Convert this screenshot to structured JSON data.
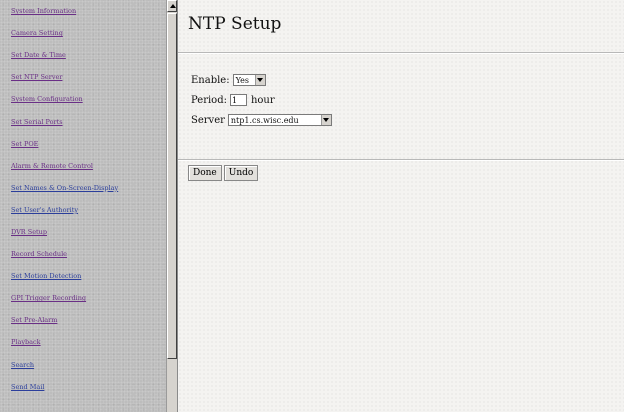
{
  "sidebar": {
    "items": [
      {
        "label": "System Information",
        "color": "#6a2f86"
      },
      {
        "label": "Camera Setting",
        "color": "#6a2f86"
      },
      {
        "label": "Set Date & Time",
        "color": "#6a2f86"
      },
      {
        "label": "Set NTP Server",
        "color": "#6a2f86"
      },
      {
        "label": "System Configuration",
        "color": "#6a2f86"
      },
      {
        "label": "Set Serial Ports",
        "color": "#6a2f86"
      },
      {
        "label": "Set POE",
        "color": "#6a2f86"
      },
      {
        "label": "Alarm & Remote Control",
        "color": "#6a2f86"
      },
      {
        "label": "Set Names & On-Screen-Display",
        "color": "#2b3e9b"
      },
      {
        "label": "Set User's Authority",
        "color": "#2b3e9b"
      },
      {
        "label": "DVR Setup",
        "color": "#6a2f86"
      },
      {
        "label": "Record Schedule",
        "color": "#6a2f86"
      },
      {
        "label": "Set Motion Detection",
        "color": "#2b3e9b"
      },
      {
        "label": "GPI Trigger Recording",
        "color": "#6a2f86"
      },
      {
        "label": "Set Pre-Alarm",
        "color": "#6a2f86"
      },
      {
        "label": "Playback",
        "color": "#6a2f86"
      },
      {
        "label": "Search",
        "color": "#2b3e9b"
      },
      {
        "label": "Send Mail",
        "color": "#2b3e9b"
      }
    ]
  },
  "main": {
    "title": "NTP Setup",
    "enable": {
      "label": "Enable:",
      "value": "Yes"
    },
    "period": {
      "label": "Period:",
      "value": "1",
      "unit": "hour"
    },
    "server": {
      "label": "Server",
      "value": "ntp1.cs.wisc.edu"
    },
    "buttons": {
      "done": "Done",
      "undo": "Undo"
    }
  }
}
